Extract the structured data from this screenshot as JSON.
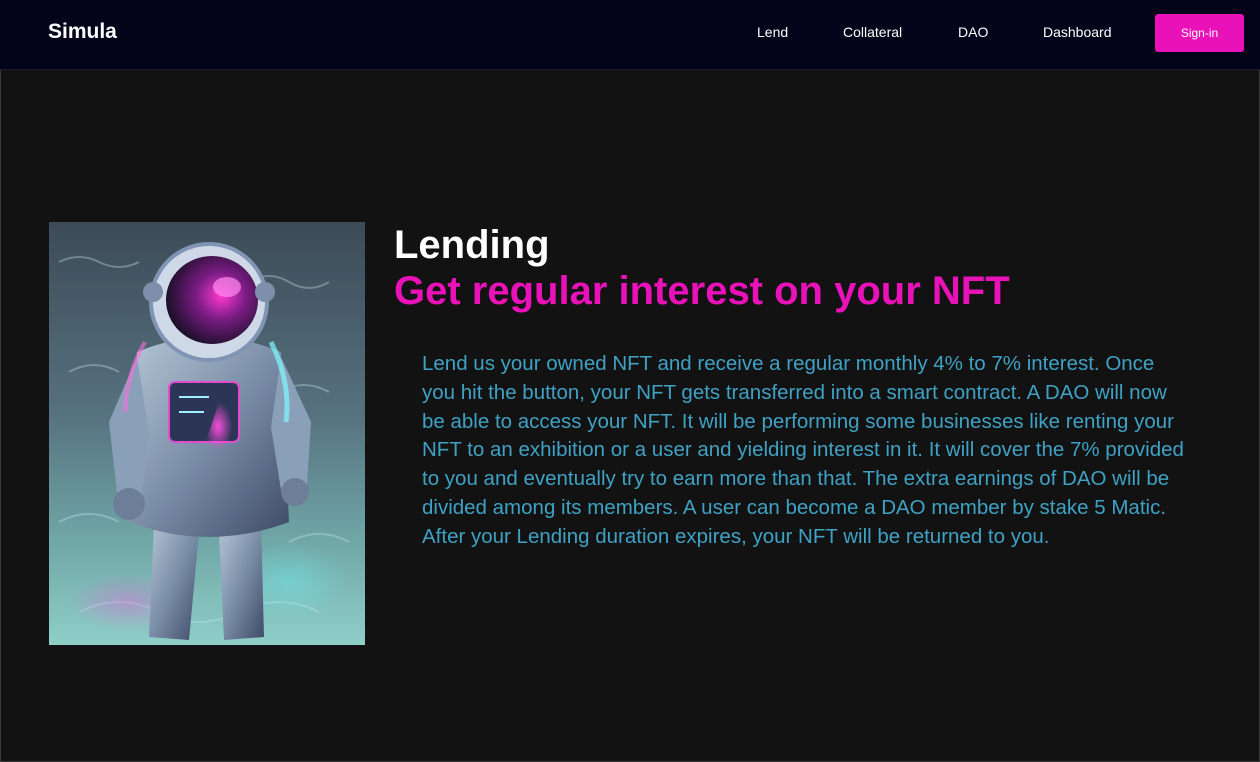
{
  "navbar": {
    "brand": "Simula",
    "links": [
      {
        "label": "Lend"
      },
      {
        "label": "Collateral"
      },
      {
        "label": "DAO"
      },
      {
        "label": "Dashboard"
      }
    ],
    "signin_label": "Sign-in"
  },
  "hero": {
    "title": "Lending",
    "subtitle": "Get regular interest on your NFT",
    "description": "Lend us your owned NFT and receive a regular monthly 4% to 7% interest. Once you hit the button, your NFT gets transferred into a smart contract. A DAO will now be able to access your NFT. It will be performing some businesses like renting your NFT to an exhibition or a user and yielding interest in it. It will cover the 7% provided to you and eventually try to earn more than that. The extra earnings of DAO will be divided among its members. A user can become a DAO member by stake 5 Matic. After your Lending duration expires, your NFT will be returned to you.",
    "image": "astronaut-painting"
  },
  "colors": {
    "accent": "#e812b8",
    "navbar_bg": "#03031a",
    "page_bg": "#121212",
    "body_text": "#3fa2c4"
  }
}
